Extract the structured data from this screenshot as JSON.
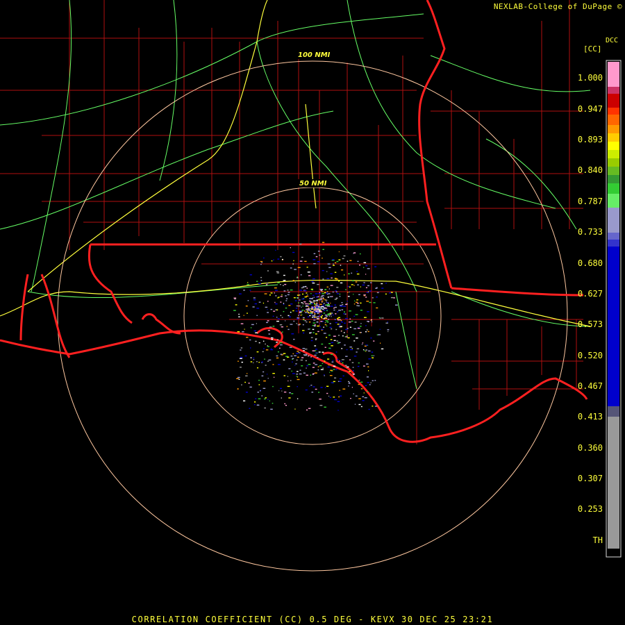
{
  "header": {
    "credit": "NEXLAB-College of DuPage ©",
    "product_code": "DCC",
    "units": "[CC]"
  },
  "footer": {
    "caption": "CORRELATION COEFFICIENT (CC) 0.5 DEG - KEVX 30 DEC 25 23:21"
  },
  "range_rings": {
    "inner_label": "50 NMI",
    "outer_label": "100 NMI"
  },
  "legend": {
    "labels": [
      "1.000",
      "0.947",
      "0.893",
      "0.840",
      "0.787",
      "0.733",
      "0.680",
      "0.627",
      "0.573",
      "0.520",
      "0.467",
      "0.413",
      "0.360",
      "0.307",
      "0.253",
      "TH"
    ],
    "colors": {
      "pink": "#ff99cc",
      "rose": "#cc3366",
      "red": "#cc0000",
      "orange": "#ff6600",
      "yellow": "#ffff00",
      "green": "#33cc33",
      "lavender": "#9999cc",
      "blue": "#0000cc",
      "gray": "#999999",
      "th": "#000000"
    }
  },
  "map_colors": {
    "county_lines": "#b01010",
    "state_lines": "#ff2020",
    "highways_minor": "#66ff66",
    "highways_major": "#ffff3c",
    "range_rings": "#ffc8a0"
  }
}
